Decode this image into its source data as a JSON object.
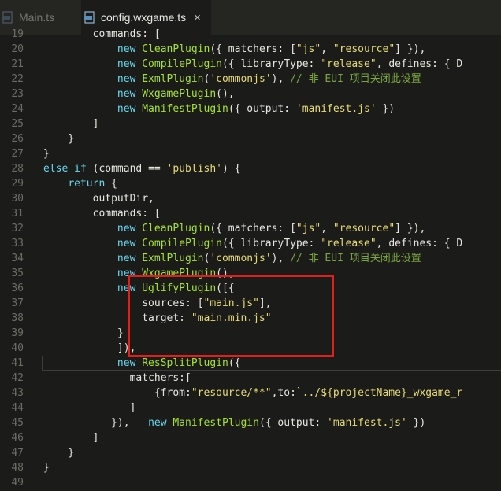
{
  "tabs": [
    {
      "label": "Main.ts",
      "icon": "typescript-file-icon",
      "active": false
    },
    {
      "label": "config.wxgame.ts",
      "icon": "typescript-file-icon",
      "active": true,
      "close": "×"
    }
  ],
  "colors": {
    "keyword": "#66d9ef",
    "class": "#a6e22e",
    "string": "#e6db74",
    "comment": "#7ba640",
    "highlight_border": "#e0201f"
  },
  "code": {
    "lines": [
      {
        "n": "19",
        "text": "        commands: ["
      },
      {
        "n": "20",
        "text": "            new CleanPlugin({ matchers: [\"js\", \"resource\"] }),"
      },
      {
        "n": "21",
        "text": "            new CompilePlugin({ libraryType: \"release\", defines: { D"
      },
      {
        "n": "22",
        "text": "            new ExmlPlugin('commonjs'), // 非 EUI 项目关闭此设置"
      },
      {
        "n": "23",
        "text": "            new WxgamePlugin(),"
      },
      {
        "n": "24",
        "text": "            new ManifestPlugin({ output: 'manifest.js' })"
      },
      {
        "n": "25",
        "text": "        ]"
      },
      {
        "n": "26",
        "text": "    }"
      },
      {
        "n": "27",
        "text": "}"
      },
      {
        "n": "28",
        "text": "else if (command == 'publish') {"
      },
      {
        "n": "29",
        "text": "    return {"
      },
      {
        "n": "30",
        "text": "        outputDir,"
      },
      {
        "n": "31",
        "text": "        commands: ["
      },
      {
        "n": "32",
        "text": "            new CleanPlugin({ matchers: [\"js\", \"resource\"] }),"
      },
      {
        "n": "33",
        "text": "            new CompilePlugin({ libraryType: \"release\", defines: { D"
      },
      {
        "n": "34",
        "text": "            new ExmlPlugin('commonjs'), // 非 EUI 项目关闭此设置"
      },
      {
        "n": "35",
        "text": "            new WxgamePlugin(),"
      },
      {
        "n": "36",
        "text": "            new UglifyPlugin([{"
      },
      {
        "n": "37",
        "text": "                sources: [\"main.js\"],"
      },
      {
        "n": "38",
        "text": "                target: \"main.min.js\""
      },
      {
        "n": "39",
        "text": "            }"
      },
      {
        "n": "40",
        "text": "            ]),"
      },
      {
        "n": "41",
        "text": "            new ResSplitPlugin({"
      },
      {
        "n": "42",
        "text": "              matchers:["
      },
      {
        "n": "43",
        "text": "                  {from:\"resource/**\",to:`../${projectName}_wxgame_r"
      },
      {
        "n": "44",
        "text": "              ]"
      },
      {
        "n": "45",
        "text": "           }),   new ManifestPlugin({ output: 'manifest.js' })"
      },
      {
        "n": "46",
        "text": "        ]"
      },
      {
        "n": "47",
        "text": "    }"
      },
      {
        "n": "48",
        "text": "}"
      },
      {
        "n": "49",
        "text": ""
      }
    ]
  }
}
